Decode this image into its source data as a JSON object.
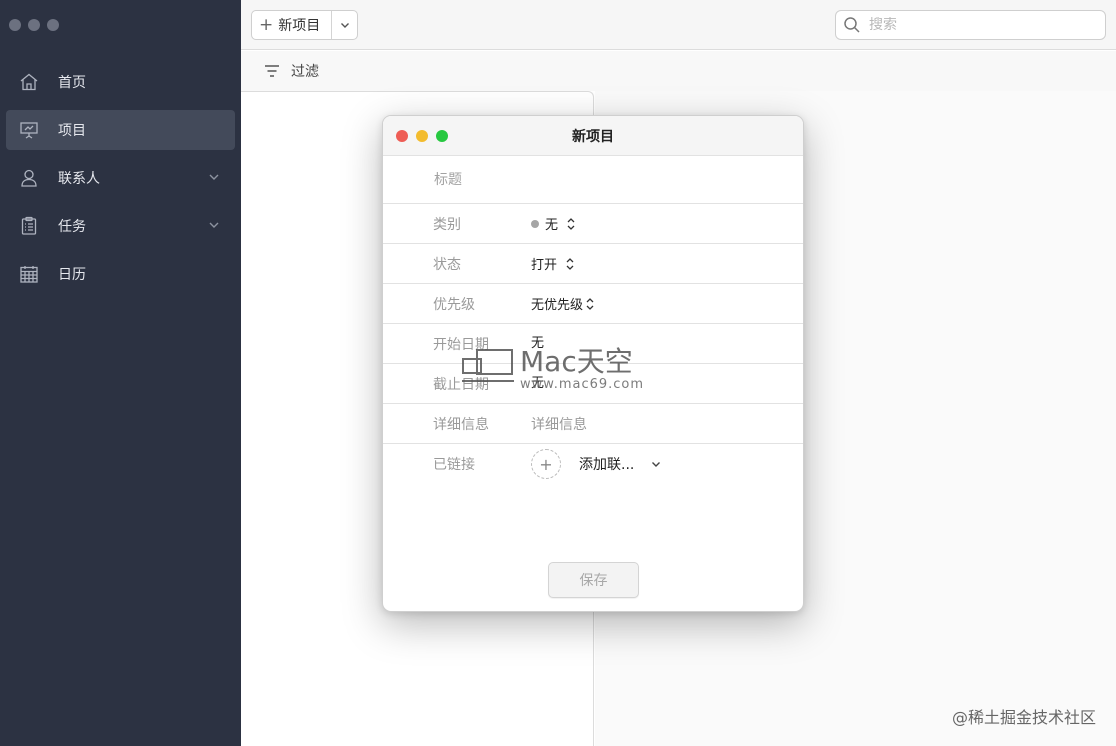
{
  "sidebar": {
    "items": [
      {
        "label": "首页",
        "icon": "home-icon"
      },
      {
        "label": "项目",
        "icon": "presentation-icon",
        "active": true
      },
      {
        "label": "联系人",
        "icon": "person-icon",
        "expandable": true
      },
      {
        "label": "任务",
        "icon": "clipboard-icon",
        "expandable": true
      },
      {
        "label": "日历",
        "icon": "calendar-icon"
      }
    ]
  },
  "toolbar": {
    "new_label": "新项目",
    "search_placeholder": "搜索"
  },
  "filterbar": {
    "label": "过滤"
  },
  "modal": {
    "title": "新项目",
    "title_placeholder": "标题",
    "fields": {
      "category": {
        "label": "类别",
        "value": "无"
      },
      "status": {
        "label": "状态",
        "value": "打开"
      },
      "priority": {
        "label": "优先级",
        "value": "无优先级"
      },
      "start_date": {
        "label": "开始日期",
        "value": "无"
      },
      "due_date": {
        "label": "截止日期",
        "value": "无"
      },
      "details": {
        "label": "详细信息",
        "placeholder": "详细信息"
      },
      "linked": {
        "label": "已链接",
        "add_label": "添加联..."
      }
    },
    "save_label": "保存"
  },
  "watermark": {
    "brand": "Mac天空",
    "site": "www.mac69.com",
    "footer": "@稀土掘金技术社区"
  },
  "colors": {
    "sidebar_bg": "#2c3242",
    "sidebar_active": "#434a5a",
    "close": "#ee5d55",
    "minimize": "#f3bc2e",
    "zoom": "#27c840"
  }
}
